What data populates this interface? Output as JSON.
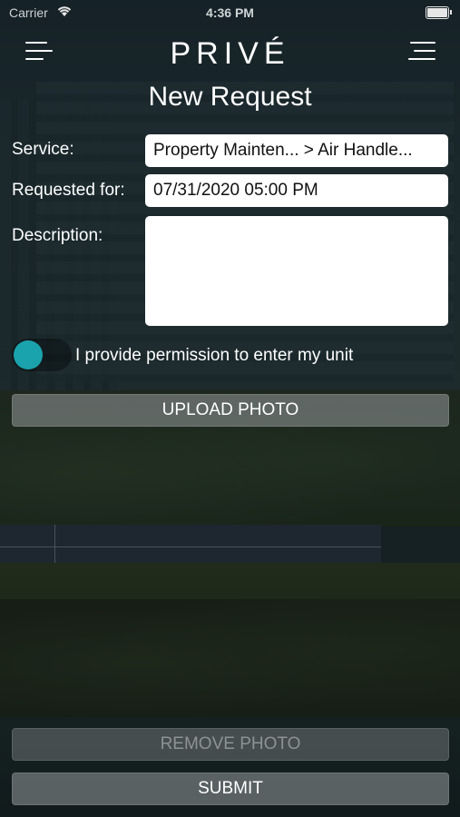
{
  "status_bar": {
    "carrier": "Carrier",
    "time": "4:36 PM"
  },
  "header": {
    "logo": "PRIVÉ",
    "title": "New Request"
  },
  "form": {
    "service_label": "Service:",
    "service_value": "Property Mainten... > Air Handle...",
    "requested_label": "Requested for:",
    "requested_value": "07/31/2020 05:00 PM",
    "description_label": "Description:",
    "description_value": "",
    "permission_text": "I provide permission to enter my unit",
    "permission_on": true
  },
  "buttons": {
    "upload": "UPLOAD PHOTO",
    "remove": "REMOVE PHOTO",
    "submit": "SUBMIT"
  },
  "colors": {
    "toggle_accent": "#1ba3ad"
  },
  "icons": [
    "wifi-icon",
    "battery-icon",
    "menu-icon"
  ]
}
